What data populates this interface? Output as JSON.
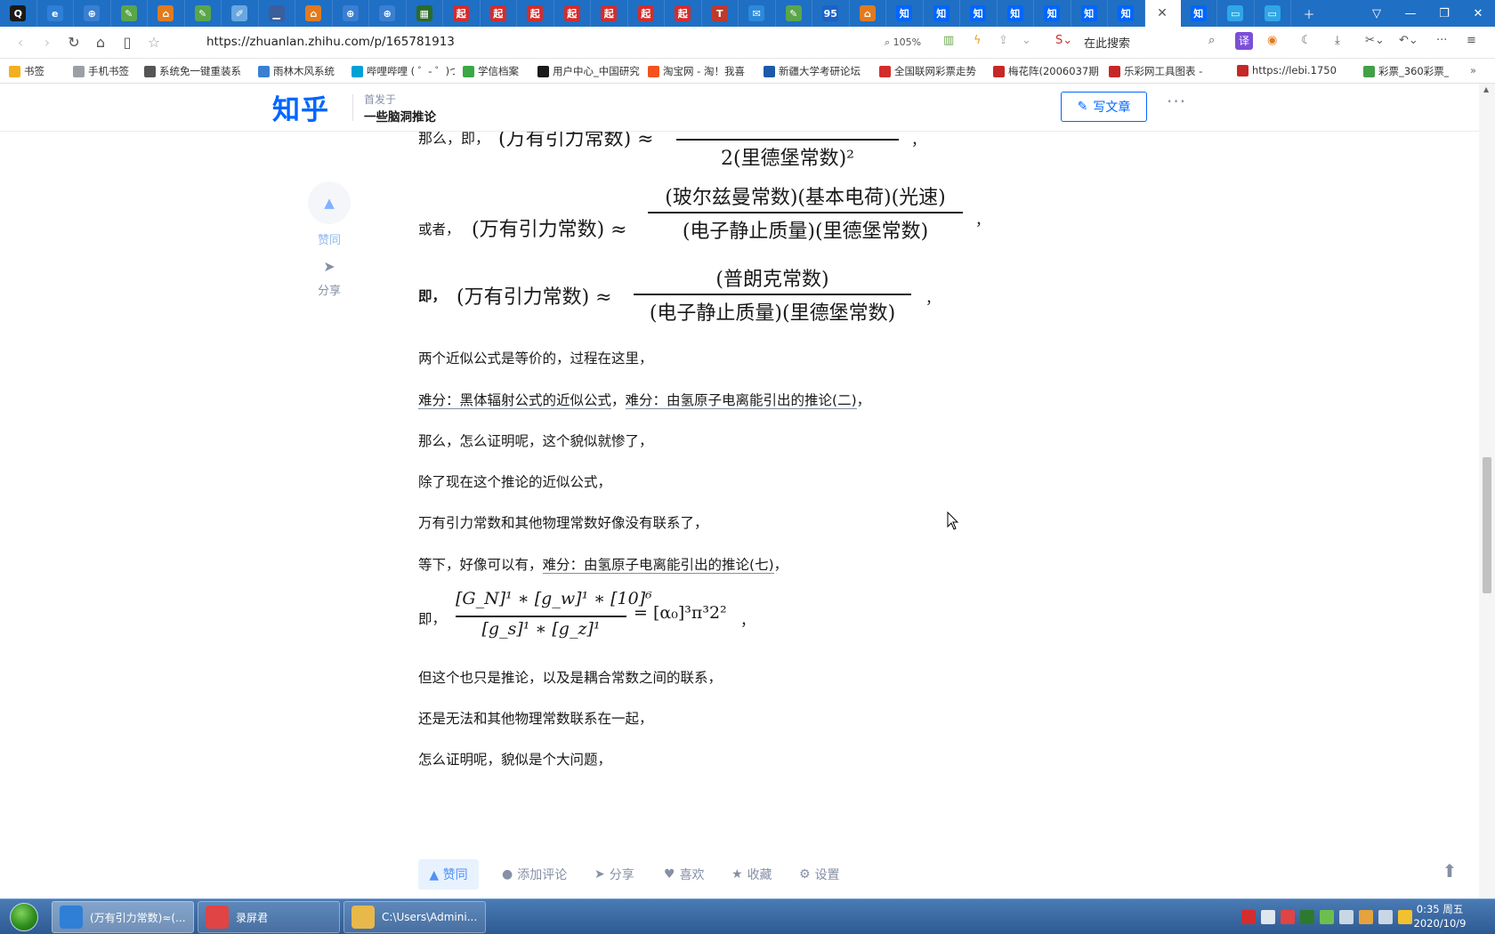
{
  "colors": {
    "tabstrip": "#1f6fc4",
    "zhihu_blue": "#0066ff",
    "gray": "#8590a6"
  },
  "tabs": [
    {
      "icon": "q-icon",
      "glyph": "Q",
      "color": "#1a1a1a"
    },
    {
      "icon": "edge-icon",
      "glyph": "e",
      "color": "#2f7fd6"
    },
    {
      "icon": "globe-icon",
      "glyph": "⊕",
      "color": "#3a7fd1"
    },
    {
      "icon": "doc-icon",
      "glyph": "✎",
      "color": "#5aa64a"
    },
    {
      "icon": "home-icon",
      "glyph": "⌂",
      "color": "#e07b1f"
    },
    {
      "icon": "doc-icon",
      "glyph": "✎",
      "color": "#5aa64a"
    },
    {
      "icon": "pen-icon",
      "glyph": "✐",
      "color": "#6aa7e0"
    },
    {
      "icon": "chart-icon",
      "glyph": "▁",
      "color": "#3b5f9c"
    },
    {
      "icon": "home-icon",
      "glyph": "⌂",
      "color": "#e07b1f"
    },
    {
      "icon": "globe-icon",
      "glyph": "⊕",
      "color": "#3a7fd1"
    },
    {
      "icon": "globe-icon",
      "glyph": "⊕",
      "color": "#3a7fd1"
    },
    {
      "icon": "grid-icon",
      "glyph": "▦",
      "color": "#2a6b2a"
    },
    {
      "icon": "qi-icon",
      "glyph": "起",
      "color": "#d32d2d"
    },
    {
      "icon": "qi-icon",
      "glyph": "起",
      "color": "#d32d2d"
    },
    {
      "icon": "qi-icon",
      "glyph": "起",
      "color": "#d32d2d"
    },
    {
      "icon": "qi-icon",
      "glyph": "起",
      "color": "#d32d2d"
    },
    {
      "icon": "qi-icon",
      "glyph": "起",
      "color": "#d32d2d"
    },
    {
      "icon": "qi-icon",
      "glyph": "起",
      "color": "#d32d2d"
    },
    {
      "icon": "qi-icon",
      "glyph": "起",
      "color": "#d32d2d"
    },
    {
      "icon": "t-icon",
      "glyph": "T",
      "color": "#c0392b"
    },
    {
      "icon": "mail-icon",
      "glyph": "✉",
      "color": "#2d89d9"
    },
    {
      "icon": "doc-icon",
      "glyph": "✎",
      "color": "#5aa64a"
    },
    {
      "icon": "num-icon",
      "glyph": "95",
      "color": "#1b63c6"
    },
    {
      "icon": "home-icon",
      "glyph": "⌂",
      "color": "#e07b1f"
    },
    {
      "icon": "zhi-icon",
      "glyph": "知",
      "color": "#0066ff"
    },
    {
      "icon": "zhi-icon",
      "glyph": "知",
      "color": "#0066ff"
    },
    {
      "icon": "zhi-icon",
      "glyph": "知",
      "color": "#0066ff"
    },
    {
      "icon": "zhi-icon",
      "glyph": "知",
      "color": "#0066ff"
    },
    {
      "icon": "zhi-icon",
      "glyph": "知",
      "color": "#0066ff"
    },
    {
      "icon": "zhi-icon",
      "glyph": "知",
      "color": "#0066ff"
    },
    {
      "icon": "zhi-icon",
      "glyph": "知",
      "color": "#0066ff"
    },
    {
      "icon": "close-icon",
      "glyph": "✕",
      "color": "#555",
      "active": true
    },
    {
      "icon": "zhi-icon",
      "glyph": "知",
      "color": "#0066ff"
    },
    {
      "icon": "tv-icon",
      "glyph": "▭",
      "color": "#2fa6e6"
    },
    {
      "icon": "tv-icon",
      "glyph": "▭",
      "color": "#2fa6e6"
    }
  ],
  "address": {
    "url": "https://zhuanlan.zhihu.com/p/165781913",
    "zoom": "105%",
    "search_label": "在此搜索",
    "translate_label": "译"
  },
  "bookmarks": [
    {
      "label": "书签",
      "color": "#f2b01e"
    },
    {
      "label": "手机书签",
      "color": "#9aa0a6"
    },
    {
      "label": "系统免一键重装系",
      "color": "#555"
    },
    {
      "label": "雨林木风系统",
      "color": "#3a7fd1"
    },
    {
      "label": "哔哩哔哩 ( ゜- ゜)つ",
      "color": "#00a1d6"
    },
    {
      "label": "学信档案",
      "color": "#39a845"
    },
    {
      "label": "用户中心_中国研究",
      "color": "#1a1a1a"
    },
    {
      "label": "淘宝网 - 淘！我喜",
      "color": "#f4511e"
    },
    {
      "label": "新疆大学考研论坛",
      "color": "#1b5aa8"
    },
    {
      "label": "全国联网彩票走势",
      "color": "#d32d2d"
    },
    {
      "label": "梅花阵(2006037期",
      "color": "#c62828"
    },
    {
      "label": "乐彩网工具图表 -",
      "color": "#c62828"
    },
    {
      "label": "https://lebi.1750",
      "color": "#c62828"
    },
    {
      "label": "彩票_360彩票_",
      "color": "#43a047"
    }
  ],
  "header": {
    "logo": "知乎",
    "first_published": "首发于",
    "column_name": "一些脑洞推论",
    "write_button": "写文章",
    "more": "···"
  },
  "side": {
    "like_label": "赞同",
    "share_label": "分享"
  },
  "formulas": {
    "f1_prefix": "那么，即，",
    "f1_lhs": "(万有引力常数) ≈",
    "f1_den": "2(里德堡常数)²",
    "f2_prefix": "或者，",
    "f2_lhs": "(万有引力常数) ≈",
    "f2_num": "(玻尔兹曼常数)(基本电荷)(光速)",
    "f2_den": "(电子静止质量)(里德堡常数)",
    "f3_prefix": "即，",
    "f3_lhs": "(万有引力常数) ≈",
    "f3_num": "(普朗克常数)",
    "f3_den": "(电子静止质量)(里德堡常数)",
    "comma": "，",
    "f4_prefix": "即，",
    "f4_num": "[G_N]¹ ∗ [g_w]¹ ∗ [10]⁶",
    "f4_den": "[g_s]¹ ∗ [g_z]¹",
    "f4_rhs": "= [α₀]³π³2²"
  },
  "paragraphs": {
    "p1": "两个近似公式是等价的，过程在这里，",
    "p2_link1": "难分：黑体辐射公式的近似公式",
    "p2_sep": "，",
    "p2_link2": "难分：由氢原子电离能引出的推论(二)",
    "p2_end": "，",
    "p3": "那么，怎么证明呢，这个貌似就惨了，",
    "p4": "除了现在这个推论的近似公式，",
    "p5": "万有引力常数和其他物理常数好像没有联系了，",
    "p6_pre": "等下，好像可以有，",
    "p6_link": "难分：由氢原子电离能引出的推论(七)",
    "p6_end": "，",
    "p7": "但这个也只是推论，以及是耦合常数之间的联系，",
    "p8": "还是无法和其他物理常数联系在一起，",
    "p9": "怎么证明呢，貌似是个大问题，"
  },
  "actions": {
    "vote": "▲ 赞同",
    "comment": "添加评论",
    "share": "分享",
    "like": "喜欢",
    "favorite": "收藏",
    "settings": "设置"
  },
  "taskbar": {
    "items": [
      {
        "label": "(万有引力常数)≈(...",
        "color": "#2f7fd6",
        "active": true
      },
      {
        "label": "录屏君",
        "color": "#e04444",
        "active": false
      },
      {
        "label": "C:\\Users\\Admini...",
        "color": "#e8b84a",
        "active": false
      }
    ],
    "time": "0:35 周五",
    "date": "2020/10/9"
  }
}
